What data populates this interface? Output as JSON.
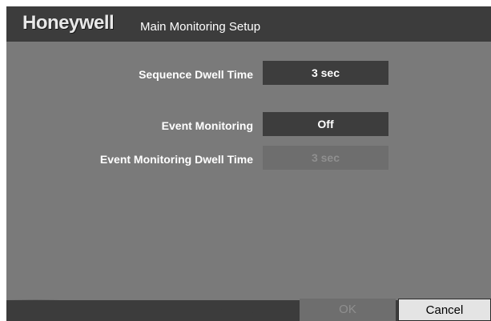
{
  "header": {
    "brand": "Honeywell",
    "title": "Main Monitoring Setup"
  },
  "settings": [
    {
      "label": "Sequence Dwell Time",
      "value": "3 sec",
      "enabled": true
    },
    {
      "label": "Event Monitoring",
      "value": "Off",
      "enabled": true
    },
    {
      "label": "Event Monitoring Dwell Time",
      "value": "3 sec",
      "enabled": false
    }
  ],
  "footer": {
    "ok_label": "OK",
    "ok_enabled": false,
    "cancel_label": "Cancel"
  },
  "colors": {
    "panel": "#7a7a7a",
    "header": "#3c3c3c",
    "field": "#3d3d3d",
    "field_disabled": "#6e6e6e",
    "button_active": "#e4e4e4"
  }
}
